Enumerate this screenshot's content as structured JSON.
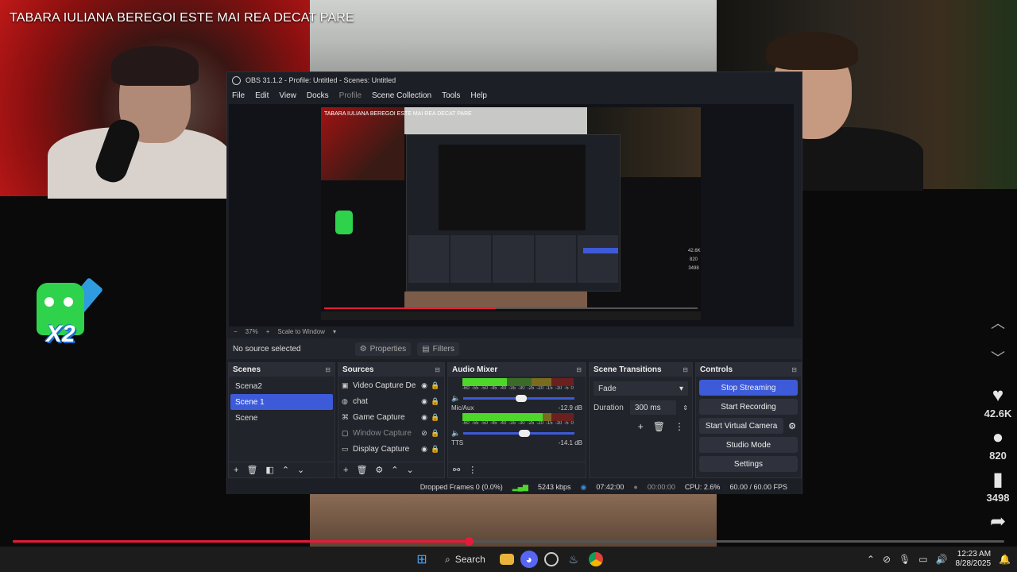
{
  "video": {
    "title": "TABARA IULIANA BEREGOI ESTE MAI REA DECAT PARE",
    "progress": 0.46
  },
  "overlay_logo": {
    "label": "X2"
  },
  "side_actions": {
    "up_icon": "chevron-up-icon",
    "down_icon": "chevron-down-icon",
    "items": [
      {
        "icon": "heart-icon",
        "glyph": "♥",
        "count": "42.6K"
      },
      {
        "icon": "comment-icon",
        "glyph": "●",
        "count": "820"
      },
      {
        "icon": "bookmark-icon",
        "glyph": "▮",
        "count": "3498"
      },
      {
        "icon": "share-icon",
        "glyph": "➦",
        "count": ""
      }
    ]
  },
  "obs": {
    "title": "OBS 31.1.2 - Profile: Untitled - Scenes: Untitled",
    "menu": [
      "File",
      "Edit",
      "View",
      "Docks",
      "Profile",
      "Scene Collection",
      "Tools",
      "Help"
    ],
    "menu_disabled": "Profile",
    "preview_title": "TABARA IULIANA BEREGOI ESTE MAI REA DECAT PARE",
    "preview_side_counts": [
      "42.6K",
      "820",
      "3498"
    ],
    "zoom": {
      "minus": "−",
      "value": "37%",
      "plus": "+",
      "mode": "Scale to Window"
    },
    "source_bar": {
      "text": "No source selected",
      "properties": "Properties",
      "filters": "Filters"
    },
    "scenes": {
      "title": "Scenes",
      "items": [
        "Scena2",
        "Scene 1",
        "Scene"
      ],
      "active_index": 1
    },
    "sources": {
      "title": "Sources",
      "items": [
        {
          "icon": "video-capture-icon",
          "glyph": "▣",
          "name": "Video Capture De",
          "visible": true
        },
        {
          "icon": "browser-icon",
          "glyph": "◍",
          "name": "chat",
          "visible": true
        },
        {
          "icon": "gamepad-icon",
          "glyph": "⌘",
          "name": "Game Capture",
          "visible": true
        },
        {
          "icon": "window-icon",
          "glyph": "▢",
          "name": "Window Capture",
          "visible": false
        },
        {
          "icon": "monitor-icon",
          "glyph": "▭",
          "name": "Display Capture",
          "visible": true
        }
      ]
    },
    "mixer": {
      "title": "Audio Mixer",
      "scale": [
        "-60",
        "-55",
        "-50",
        "-45",
        "-40",
        "-35",
        "-30",
        "-25",
        "-20",
        "-15",
        "-10",
        "-5",
        "0"
      ],
      "channels": [
        {
          "name": "",
          "db": "",
          "level": 0.4,
          "volume": 0.52
        },
        {
          "name": "Mic/Aux",
          "db": "-12.9 dB",
          "level": 0.72,
          "volume": 0.55
        },
        {
          "name": "TTS",
          "db": "-14.1 dB",
          "level": 0.0,
          "volume": 0.5
        }
      ]
    },
    "transitions": {
      "title": "Scene Transitions",
      "selected": "Fade",
      "duration_label": "Duration",
      "duration_value": "300 ms"
    },
    "controls": {
      "title": "Controls",
      "buttons": [
        "Stop Streaming",
        "Start Recording",
        "Start Virtual Camera",
        "Studio Mode",
        "Settings"
      ]
    },
    "status": {
      "dropped": "Dropped Frames 0 (0.0%)",
      "bitrate": "5243 kbps",
      "stream_time": "07:42:00",
      "rec_time": "00:00:00",
      "cpu": "CPU: 2.6%",
      "fps": "60.00 / 60.00 FPS"
    }
  },
  "taskbar": {
    "search_label": "Search",
    "time": "12:23 AM",
    "date": "8/28/2025",
    "colors": {
      "accent": "#3d5bd8",
      "live_red": "#e51b3a"
    }
  }
}
